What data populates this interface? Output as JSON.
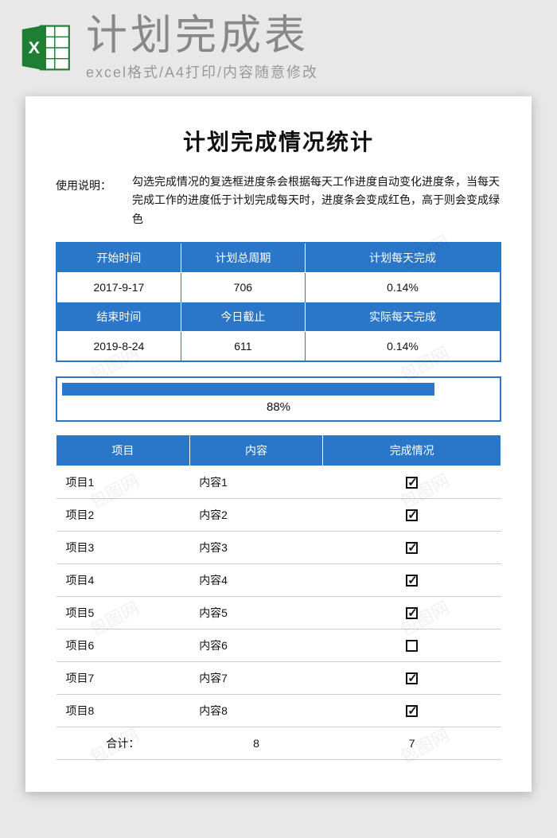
{
  "header": {
    "title": "计划完成表",
    "subtitle": "excel格式/A4打印/内容随意修改"
  },
  "document": {
    "title": "计划完成情况统计",
    "instruction_label": "使用说明：",
    "instruction_text": "勾选完成情况的复选框进度条会根据每天工作进度自动变化进度条，当每天完成工作的进度低于计划完成每天时，进度条会变成红色，高于则会变成绿色"
  },
  "info_headers_row1": {
    "c1": "开始时间",
    "c2": "计划总周期",
    "c3": "计划每天完成"
  },
  "info_values_row1": {
    "c1": "2017-9-17",
    "c2": "706",
    "c3": "0.14%"
  },
  "info_headers_row2": {
    "c1": "结束时间",
    "c2": "今日截止",
    "c3": "实际每天完成"
  },
  "info_values_row2": {
    "c1": "2019-8-24",
    "c2": "611",
    "c3": "0.14%"
  },
  "progress": {
    "percent_label": "88%",
    "fill_width": "86%"
  },
  "items_header": {
    "c1": "项目",
    "c2": "内容",
    "c3": "完成情况"
  },
  "items": [
    {
      "name": "项目1",
      "content": "内容1",
      "done": true
    },
    {
      "name": "项目2",
      "content": "内容2",
      "done": true
    },
    {
      "name": "项目3",
      "content": "内容3",
      "done": true
    },
    {
      "name": "项目4",
      "content": "内容4",
      "done": true
    },
    {
      "name": "项目5",
      "content": "内容5",
      "done": true
    },
    {
      "name": "项目6",
      "content": "内容6",
      "done": false
    },
    {
      "name": "项目7",
      "content": "内容7",
      "done": true
    },
    {
      "name": "项目8",
      "content": "内容8",
      "done": true
    }
  ],
  "sum": {
    "label": "合计：",
    "total": "8",
    "done": "7"
  },
  "watermark_text": "包图网"
}
